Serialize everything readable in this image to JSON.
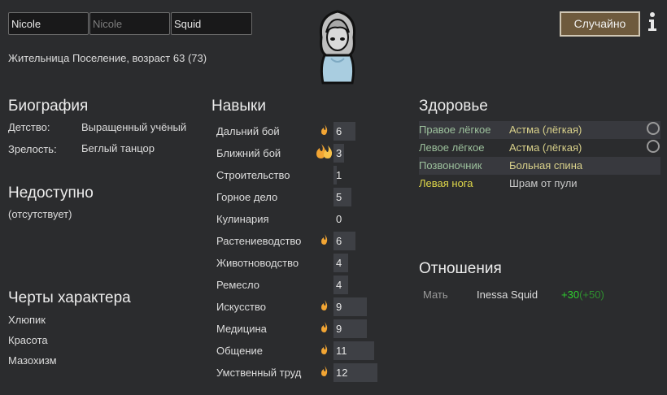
{
  "names": {
    "first_value": "Nicole",
    "nick_placeholder": "Nicole",
    "last_value": "Squid"
  },
  "random_button": "Случайно",
  "info_icon": "info-icon",
  "subtitle": "Жительница Поселение, возраст 63 (73)",
  "biography": {
    "title": "Биография",
    "childhood_label": "Детство:",
    "childhood_value": "Выращенный учёный",
    "adulthood_label": "Зрелость:",
    "adulthood_value": "Беглый танцор"
  },
  "incapable": {
    "title": "Недоступно",
    "value": "(отсутствует)"
  },
  "traits": {
    "title": "Черты характера",
    "items": [
      "Хлюпик",
      "Красота",
      "Мазохизм"
    ]
  },
  "skills": {
    "title": "Навыки",
    "items": [
      {
        "label": "Дальний бой",
        "value": "6",
        "passion": "minor"
      },
      {
        "label": "Ближний бой",
        "value": "3",
        "passion": "major"
      },
      {
        "label": "Строительство",
        "value": "1",
        "passion": "none"
      },
      {
        "label": "Горное дело",
        "value": "5",
        "passion": "none"
      },
      {
        "label": "Кулинария",
        "value": "0",
        "passion": "none"
      },
      {
        "label": "Растениеводство",
        "value": "6",
        "passion": "minor"
      },
      {
        "label": "Животноводство",
        "value": "4",
        "passion": "none"
      },
      {
        "label": "Ремесло",
        "value": "4",
        "passion": "none"
      },
      {
        "label": "Искусство",
        "value": "9",
        "passion": "minor"
      },
      {
        "label": "Медицина",
        "value": "9",
        "passion": "minor"
      },
      {
        "label": "Общение",
        "value": "11",
        "passion": "minor"
      },
      {
        "label": "Умственный труд",
        "value": "12",
        "passion": "minor"
      }
    ]
  },
  "health": {
    "title": "Здоровье",
    "rows": [
      {
        "part": "Правое лёгкое",
        "condition": "Астма (лёгкая)"
      },
      {
        "part": "Левое лёгкое",
        "condition": "Астма (лёгкая)"
      },
      {
        "part": "Позвоночник",
        "condition": "Больная спина"
      },
      {
        "part": "Левая нога",
        "condition": "Шрам от пули"
      }
    ]
  },
  "relations": {
    "title": "Отношения",
    "relation": "Мать",
    "name": "Inessa Squid",
    "opinion": "+30",
    "opinion_other": "(+50)"
  },
  "colors": {
    "background": "#2b2c2e",
    "part_green": "#9cc09c",
    "condition_yellow": "#d8d08a",
    "injury_yellow": "#e0d84a",
    "opinion_green": "#2ed12e",
    "opinion_dim": "#2f8f2f",
    "button_brown": "#6e5a3d"
  }
}
